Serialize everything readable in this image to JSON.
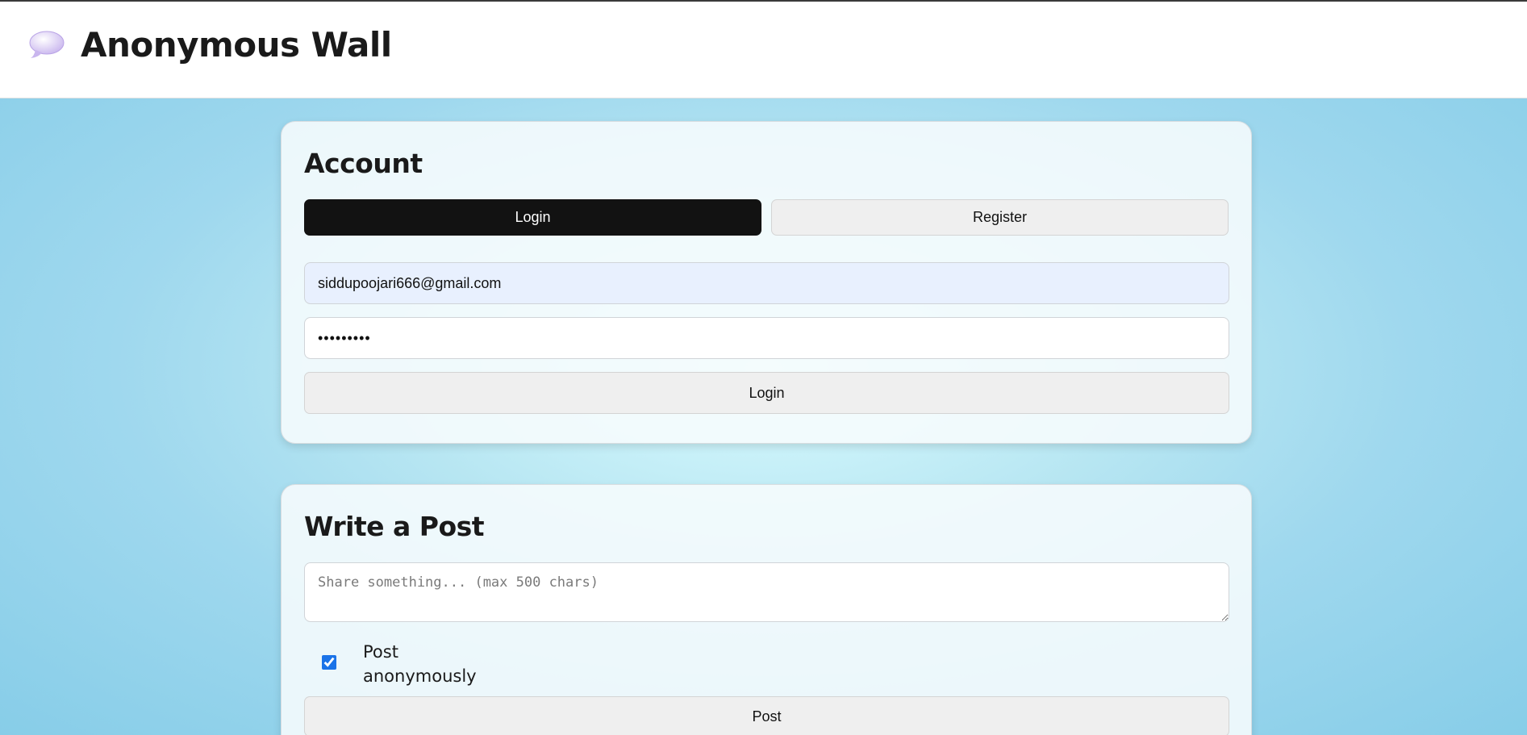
{
  "app": {
    "title": "Anonymous Wall",
    "logo_icon": "speech-bubble-icon"
  },
  "account": {
    "heading": "Account",
    "tabs": [
      {
        "label": "Login",
        "active": true
      },
      {
        "label": "Register",
        "active": false
      }
    ],
    "email": {
      "value": "siddupoojari666@gmail.com"
    },
    "password": {
      "value": "password1"
    },
    "submit_label": "Login"
  },
  "post": {
    "heading": "Write a Post",
    "placeholder": "Share something... (max 500 chars)",
    "anonymous_label": "Post anonymously",
    "anonymous_checked": true,
    "submit_label": "Post"
  },
  "colors": {
    "active_tab_bg": "#121212",
    "autofill_bg": "#e8f0fe",
    "checkbox_accent": "#1a73e8"
  }
}
